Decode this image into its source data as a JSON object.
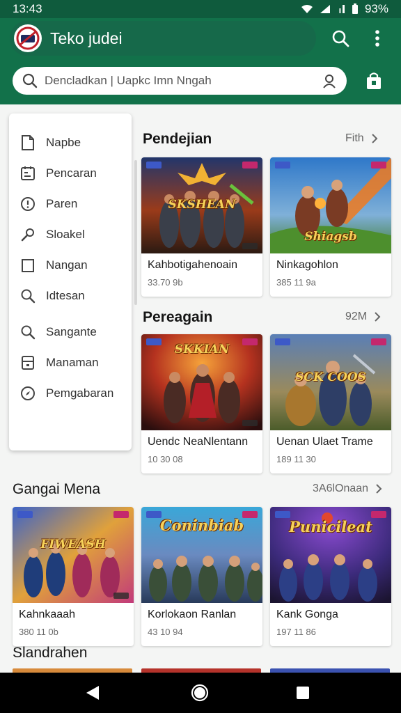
{
  "status_bar": {
    "time": "13:43",
    "battery": "93%"
  },
  "app_bar": {
    "title": "Teko judei"
  },
  "search": {
    "placeholder": "Dencladkan | Uapkc Imn Nngah"
  },
  "drawer": {
    "items": [
      {
        "label": "Napbe",
        "icon": "document-icon"
      },
      {
        "label": "Pencaran",
        "icon": "calendar-list-icon"
      },
      {
        "label": "Paren",
        "icon": "info-circle-icon"
      },
      {
        "label": "Sloakel",
        "icon": "wrench-icon"
      },
      {
        "label": "Nangan",
        "icon": "square-icon"
      },
      {
        "label": "Idtesan",
        "icon": "search-icon"
      },
      {
        "label": "Sangante",
        "icon": "search-icon"
      },
      {
        "label": "Manaman",
        "icon": "wallet-icon"
      },
      {
        "label": "Pemgabaran",
        "icon": "compass-icon"
      }
    ]
  },
  "sections": [
    {
      "title": "Pendejian",
      "link": "Fith",
      "cards": [
        {
          "title": "Kahbotigahenoain",
          "meta": "33.70 9b",
          "logo": "SKSHEAN"
        },
        {
          "title": "Ninkagohlon",
          "meta": "385 11 9a",
          "logo": "Shiagsb"
        }
      ]
    },
    {
      "title": "Pereagain",
      "link": "92M",
      "cards": [
        {
          "title": "Uendc NeaNlentann",
          "meta": "10 30 08",
          "logo": "SKKIAN"
        },
        {
          "title": "Uenan Ulaet Trame",
          "meta": "189 11 30",
          "logo": "SCK COOS"
        }
      ]
    },
    {
      "title": "Gangai Mena",
      "link": "3A6lOnaan",
      "cards": [
        {
          "title": "Kahnkaaah",
          "meta": "380 11 0b",
          "logo": "FIWEASH"
        },
        {
          "title": "Korlokaon Ranlan",
          "meta": "43 10 94",
          "logo": "Coninbiab"
        },
        {
          "title": "Kank Gonga",
          "meta": "197 11 86",
          "logo": "Punicileat"
        }
      ]
    },
    {
      "title": "Slandrahen"
    }
  ],
  "colors": {
    "app_bar": "#12714a",
    "status_bar": "#0f5b3d",
    "background": "#f4f5f4",
    "card": "#ffffff"
  },
  "nav_bar": {
    "buttons": [
      "back-icon",
      "home-icon",
      "recents-icon"
    ]
  }
}
